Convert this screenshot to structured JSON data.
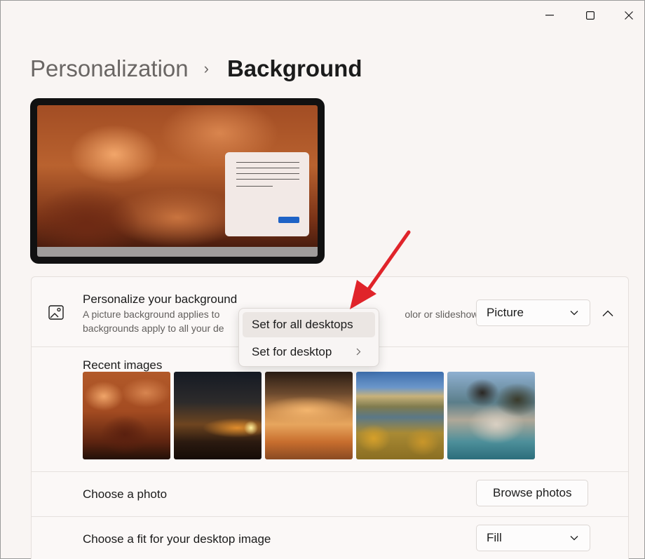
{
  "breadcrumb": {
    "parent": "Personalization",
    "separator": "›",
    "current": "Background"
  },
  "background_row": {
    "title": "Personalize your background",
    "description_line1": "A picture background applies to",
    "description_line1_tail": "olor or slideshow",
    "description_line2": "backgrounds apply to all your de",
    "dropdown_value": "Picture"
  },
  "recent_images": {
    "label": "Recent images",
    "items": [
      "storm-clouds-lightning",
      "moon-over-sunset-clouds",
      "rhino-in-water-at-sunset",
      "lake-with-autumn-trees",
      "granite-boulders-by-sea"
    ]
  },
  "choose_photo": {
    "label": "Choose a photo",
    "button": "Browse photos"
  },
  "choose_fit": {
    "label": "Choose a fit for your desktop image",
    "dropdown_value": "Fill"
  },
  "context_menu": {
    "items": [
      {
        "label": "Set for all desktops"
      },
      {
        "label": "Set for desktop"
      }
    ]
  },
  "colors": {
    "accent": "#1f63c6",
    "annotation_arrow": "#e0242a"
  }
}
